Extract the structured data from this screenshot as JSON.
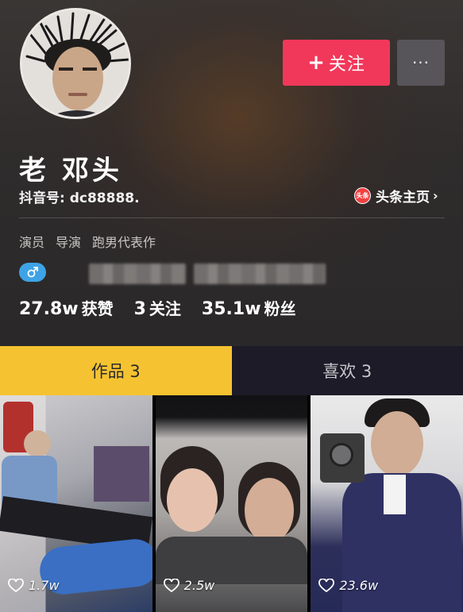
{
  "profile": {
    "name": "老 邓头",
    "douyin_id": "抖音号: dc88888.",
    "toutiao_icon_text": "头条",
    "toutiao_link": "头条主页",
    "tags": [
      "演员",
      "导演",
      "跑男代表作"
    ],
    "stats": {
      "likes_num": "27.8w",
      "likes_label": "获赞",
      "following_num": "3",
      "following_label": "关注",
      "fans_num": "35.1w",
      "fans_label": "粉丝"
    }
  },
  "actions": {
    "follow_label": "关注",
    "more_label": "···"
  },
  "tabs": [
    {
      "label": "作品 3",
      "active": true
    },
    {
      "label": "喜欢 3",
      "active": false
    }
  ],
  "videos": [
    {
      "likes": "1.7w"
    },
    {
      "likes": "2.5w"
    },
    {
      "likes": "23.6w"
    }
  ],
  "colors": {
    "follow": "#f2385a",
    "tab_active": "#f5c331",
    "gender_badge": "#3ea3e6",
    "background": "#161823"
  },
  "icons": {
    "gender": "male-icon",
    "like": "heart-icon",
    "chevron": "chevron-right-icon",
    "more": "more-icon"
  }
}
